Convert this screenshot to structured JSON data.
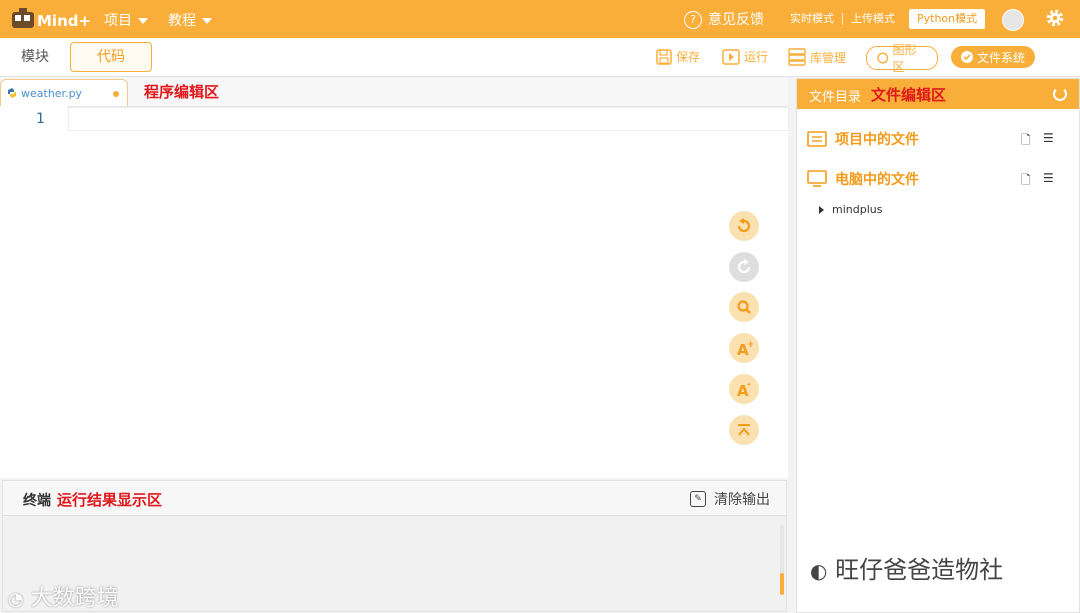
{
  "app": {
    "logo_text": "Mind+"
  },
  "topbar": {
    "menus": [
      {
        "label": "项目"
      },
      {
        "label": "教程"
      }
    ],
    "feedback_label": "意见反馈",
    "modes": [
      {
        "label": "实时模式"
      },
      {
        "label": "上传模式"
      },
      {
        "label": "Python模式",
        "active": true
      }
    ],
    "accent_color": "#f8ae39"
  },
  "toolbar": {
    "tabs": [
      {
        "label": "模块"
      },
      {
        "label": "代码",
        "active": true
      }
    ],
    "save_label": "保存",
    "run_label": "运行",
    "library_label": "库管理",
    "graph_label": "图形区",
    "filesystem_label": "文件系统"
  },
  "editor": {
    "file_tab": "weather.py",
    "annotation": "程序编辑区",
    "line_numbers": [
      "1"
    ],
    "side_tools": [
      "undo-icon",
      "redo-icon",
      "search-icon",
      "font-increase-icon",
      "font-decrease-icon",
      "scroll-top-icon"
    ]
  },
  "terminal": {
    "title": "终端",
    "annotation": "运行结果显示区",
    "clear_label": "清除输出"
  },
  "file_panel": {
    "title": "文件目录",
    "annotation": "文件编辑区",
    "sections": [
      {
        "label": "项目中的文件"
      },
      {
        "label": "电脑中的文件"
      }
    ],
    "tree": [
      {
        "label": "mindplus"
      }
    ]
  },
  "watermarks": {
    "left": "大数跨境",
    "right": "旺仔爸爸造物社"
  }
}
